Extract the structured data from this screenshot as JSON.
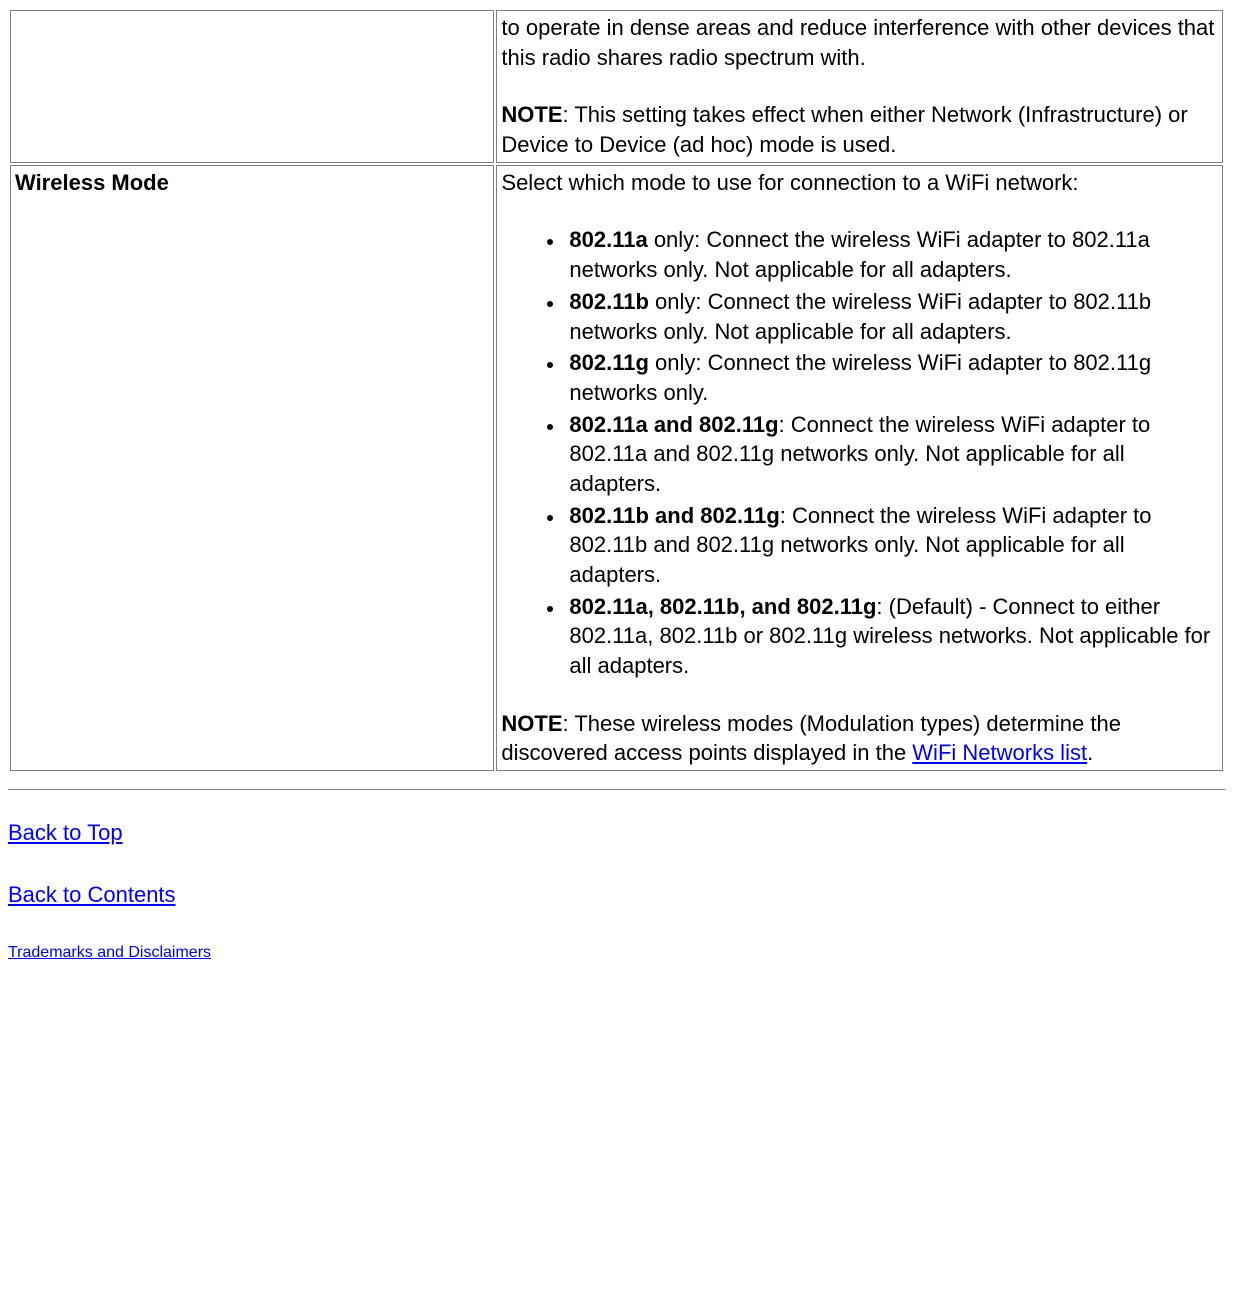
{
  "row1": {
    "desc_p1": "to operate in dense areas and reduce interference with other devices that this radio shares radio spectrum with.",
    "note_label": "NOTE",
    "note_text": ": This setting takes effect when either Network (Infrastructure) or Device to Device (ad hoc) mode is used."
  },
  "row2": {
    "label": "Wireless Mode",
    "intro": "Select which mode to use for connection to a WiFi network:",
    "items": [
      {
        "bold": "802.11a",
        "rest": " only: Connect the wireless WiFi adapter to 802.11a networks only. Not applicable for all adapters."
      },
      {
        "bold": "802.11b",
        "rest": " only: Connect the wireless WiFi adapter to 802.11b networks only. Not applicable for all adapters."
      },
      {
        "bold": "802.11g",
        "rest": " only: Connect the wireless WiFi adapter to 802.11g networks only."
      },
      {
        "bold": "802.11a and 802.11g",
        "rest": ": Connect the wireless WiFi adapter to 802.11a and 802.11g networks only. Not applicable for all adapters."
      },
      {
        "bold": "802.11b and 802.11g",
        "rest": ": Connect the wireless WiFi adapter to 802.11b and 802.11g networks only. Not applicable for all adapters."
      },
      {
        "bold": "802.11a, 802.11b, and 802.11g",
        "rest": ": (Default) - Connect to either 802.11a, 802.11b or 802.11g wireless networks. Not applicable for all adapters."
      }
    ],
    "note_label": "NOTE",
    "note_pre": ": These wireless modes (Modulation types) determine the discovered access points displayed in the ",
    "note_link": "WiFi Networks list",
    "note_post": "."
  },
  "nav": {
    "back_to_top": "Back to Top",
    "back_to_contents": "Back to Contents",
    "trademarks": "Trademarks and Disclaimers"
  }
}
